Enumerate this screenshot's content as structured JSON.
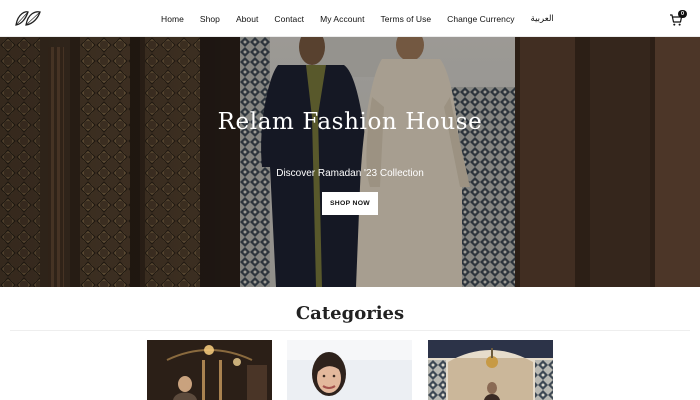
{
  "header": {
    "logo_icon": "double-leaf-logo-icon",
    "nav": [
      {
        "label": "Home"
      },
      {
        "label": "Shop"
      },
      {
        "label": "About"
      },
      {
        "label": "Contact"
      },
      {
        "label": "My Account"
      },
      {
        "label": "Terms of Use"
      },
      {
        "label": "Change Currency"
      },
      {
        "label": "العربية"
      }
    ],
    "cart_icon": "shopping-cart-icon",
    "cart_count": "0"
  },
  "hero": {
    "title": "Relam Fashion House",
    "subtitle": "Discover Ramadan '23 Collection",
    "button_label": "SHOP NOW"
  },
  "categories": {
    "title": "Categories",
    "cards": [
      {
        "image": "woman-in-lantern-lit-room"
      },
      {
        "image": "smiling-woman-portrait"
      },
      {
        "image": "woman-in-mosaic-archway"
      }
    ]
  },
  "colors": {
    "button_bg": "#ffffff",
    "cart_badge": "#111111",
    "text": "#111111"
  }
}
